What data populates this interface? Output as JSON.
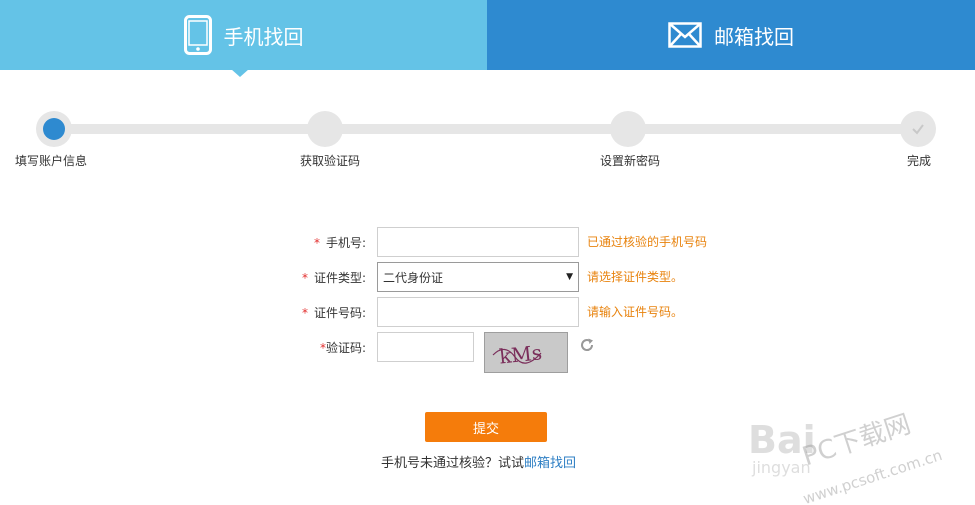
{
  "tabs": [
    {
      "label": "手机找回",
      "icon": "phone-icon",
      "active": true
    },
    {
      "label": "邮箱找回",
      "icon": "mail-icon",
      "active": false
    }
  ],
  "steps": [
    {
      "label": "填写账户信息",
      "state": "current"
    },
    {
      "label": "获取验证码",
      "state": "pending"
    },
    {
      "label": "设置新密码",
      "state": "pending"
    },
    {
      "label": "完成",
      "state": "pending"
    }
  ],
  "form": {
    "required_mark": "*",
    "phone": {
      "label": "手机号:",
      "value": "",
      "hint": "已通过核验的手机号码"
    },
    "id_type": {
      "label": "证件类型:",
      "selected": "二代身份证",
      "hint": "请选择证件类型。"
    },
    "id_number": {
      "label": "证件号码:",
      "value": "",
      "hint": "请输入证件号码。"
    },
    "captcha": {
      "label": "验证码:",
      "value": "",
      "image_text": "kMs"
    }
  },
  "submit_label": "提交",
  "footer": {
    "text": "手机号未通过核验？试试",
    "link": "邮箱找回"
  },
  "watermarks": {
    "baidu": "Bai",
    "jingyan": "jingyan",
    "site_cn": "PC下载网",
    "site_url": "www.pcsoft.com.cn"
  },
  "colors": {
    "tab_active": "#64c3e7",
    "tab_inactive": "#2e8ad0",
    "accent": "#2e8ad0",
    "hint": "#e8830e",
    "button": "#f57c0b",
    "required": "#e3302f",
    "link": "#2e7fc4"
  }
}
